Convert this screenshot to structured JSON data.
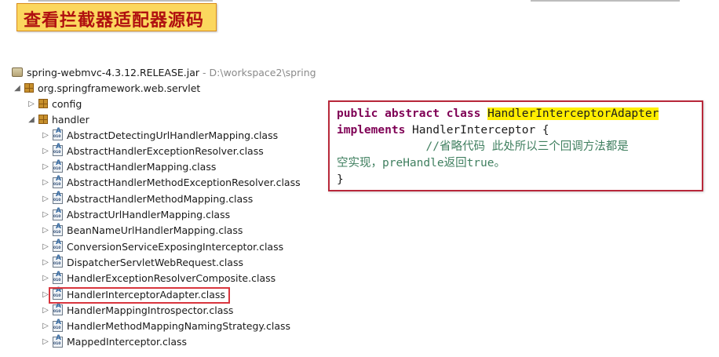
{
  "title": "查看拦截器适配器源码",
  "tree": {
    "jar": {
      "label": "spring-webmvc-4.3.12.RELEASE.jar",
      "path": "- D:\\workspace2\\spring"
    },
    "package": "org.springframework.web.servlet",
    "folders": {
      "config": "config",
      "handler": "handler"
    },
    "classes": [
      "AbstractDetectingUrlHandlerMapping.class",
      "AbstractHandlerExceptionResolver.class",
      "AbstractHandlerMapping.class",
      "AbstractHandlerMethodExceptionResolver.class",
      "AbstractHandlerMethodMapping.class",
      "AbstractUrlHandlerMapping.class",
      "BeanNameUrlHandlerMapping.class",
      "ConversionServiceExposingInterceptor.class",
      "DispatcherServletWebRequest.class",
      "HandlerExceptionResolverComposite.class",
      "HandlerInterceptorAdapter.class",
      "HandlerMappingIntrospector.class",
      "HandlerMethodMappingNamingStrategy.class",
      "MappedInterceptor.class"
    ],
    "selected_class": "HandlerInterceptorAdapter.class"
  },
  "code": {
    "kw1": "public",
    "kw2": "abstract",
    "kw3": "class",
    "class_name": "HandlerInterceptorAdapter",
    "kw4": "implements",
    "interface_name": "HandlerInterceptor",
    "open_brace": "{",
    "comment_indent": "             ",
    "comment": "//省略代码 此处所以三个回调方法都是",
    "comment_cont": "空实现，preHandle返回true。",
    "close_brace": "}"
  },
  "colors": {
    "banner_bg": "#fbd75e",
    "title_text": "#b01010",
    "highlight_border": "#d9363e",
    "code_border": "#b8283a",
    "keyword": "#7f0055",
    "name_highlight": "#ffee00"
  }
}
